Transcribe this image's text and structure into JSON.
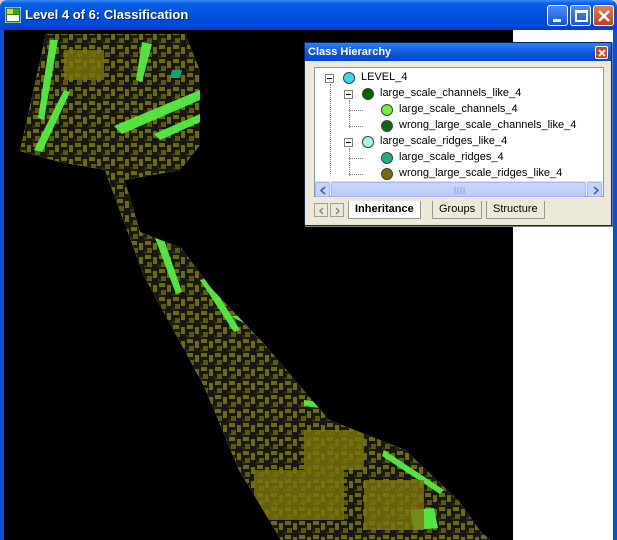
{
  "window": {
    "title": "Level 4 of 6: Classification",
    "icon": "classification-app-icon"
  },
  "panel": {
    "title": "Class Hierarchy",
    "tree": [
      {
        "label": "LEVEL_4",
        "color": "#33ddee",
        "level": 0
      },
      {
        "label": "large_scale_channels_like_4",
        "color": "#006600",
        "level": 1
      },
      {
        "label": "large_scale_channels_4",
        "color": "#77ee44",
        "level": 2
      },
      {
        "label": "wrong_large_scale_channels_like_4",
        "color": "#0a6a14",
        "level": 2
      },
      {
        "label": "large_scale_ridges_like_4",
        "color": "#aaf4f4",
        "level": 1
      },
      {
        "label": "large_scale_ridges_4",
        "color": "#20b07a",
        "level": 2
      },
      {
        "label": "wrong_large_scale_ridges_like_4",
        "color": "#7a6a08",
        "level": 2
      }
    ],
    "tabs": [
      "Inheritance",
      "Groups",
      "Structure"
    ],
    "active_tab": "Inheritance"
  },
  "colors": {
    "titlebar": "#0050e0",
    "canvas_background": "#000000",
    "olive_class": "#6e6a10",
    "channel_class": "#55ee44",
    "ridge_class": "#10a880"
  }
}
